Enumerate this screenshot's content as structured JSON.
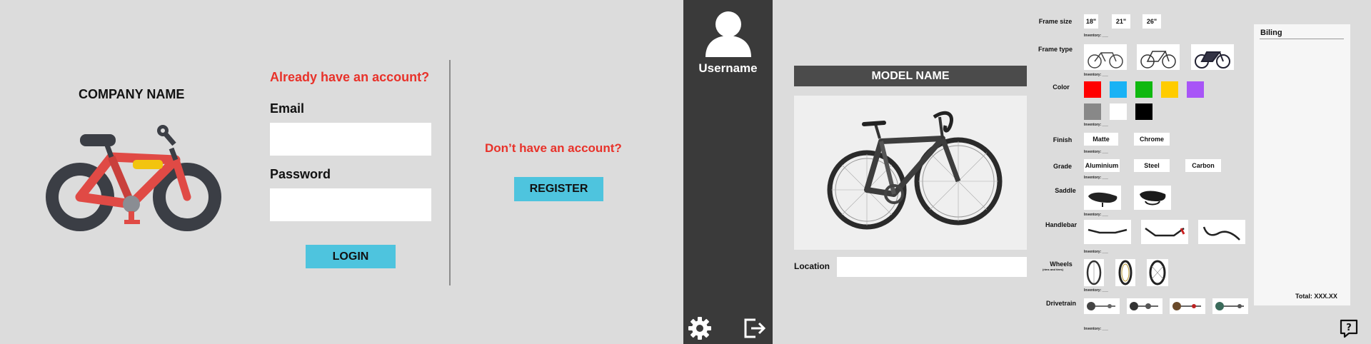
{
  "login": {
    "company_name": "COMPANY NAME",
    "already_text": "Already have an account?",
    "email_label": "Email",
    "email_value": "",
    "password_label": "Password",
    "password_value": "",
    "login_label": "LOGIN",
    "dont_have_text": "Don’t have an account?",
    "register_label": "REGISTER"
  },
  "sidebar": {
    "username": "Username",
    "icons": [
      "user-avatar-icon",
      "gear-icon",
      "logout-icon"
    ]
  },
  "model": {
    "name": "MODEL NAME",
    "location_label": "Location",
    "location_value": ""
  },
  "config": {
    "inventory_text": "Inventory: ___",
    "frame_size": {
      "label": "Frame size",
      "options": [
        "18\"",
        "21\"",
        "26\""
      ]
    },
    "frame_type": {
      "label": "Frame type",
      "options": [
        "city-bike",
        "road-bike",
        "cruiser-bike"
      ]
    },
    "color": {
      "label": "Color",
      "swatches": [
        "#ff0000",
        "#19b2f5",
        "#0fb80f",
        "#ffcc00",
        "#a855f7",
        "#888888",
        "#ffffff",
        "#000000"
      ]
    },
    "finish": {
      "label": "Finish",
      "options": [
        "Matte",
        "Chrome"
      ]
    },
    "grade": {
      "label": "Grade",
      "options": [
        "Aluminium",
        "Steel",
        "Carbon"
      ]
    },
    "saddle": {
      "label": "Saddle",
      "options": [
        "saddle-1",
        "saddle-2"
      ]
    },
    "handlebar": {
      "label": "Handlebar",
      "options": [
        "flat-bar",
        "riser-bar",
        "drop-bar"
      ]
    },
    "wheels": {
      "label": "Wheels",
      "sublabel": "(rims and tires)",
      "options": [
        "wheel-1",
        "wheel-2",
        "wheel-3"
      ]
    },
    "drivetrain": {
      "label": "Drivetrain",
      "options": [
        "drivetrain-1",
        "drivetrain-2",
        "drivetrain-3",
        "drivetrain-4"
      ]
    }
  },
  "billing": {
    "title": "Biling",
    "total": "Total: XXX.XX"
  }
}
